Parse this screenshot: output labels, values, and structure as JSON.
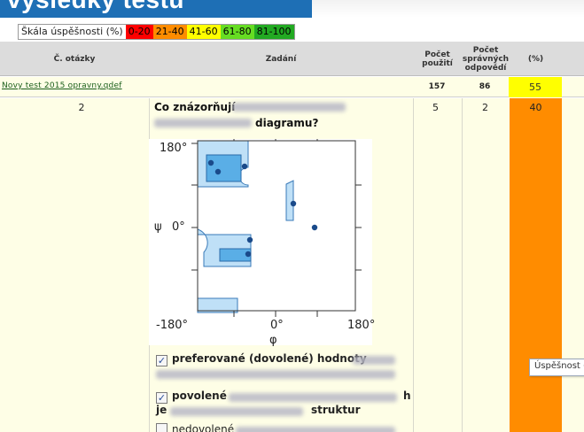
{
  "banner": {
    "title": "výsledky testu",
    "color": "#1e6fb5"
  },
  "scale": {
    "label": "Škála úspěšnosti (%)",
    "ranges": [
      {
        "text": "0-20",
        "color": "#ff0000"
      },
      {
        "text": "21-40",
        "color": "#ff8c00"
      },
      {
        "text": "41-60",
        "color": "#ffff00"
      },
      {
        "text": "61-80",
        "color": "#66dd22"
      },
      {
        "text": "81-100",
        "color": "#22aa22"
      }
    ]
  },
  "table": {
    "headers": {
      "question_no": "Č. otázky",
      "assignment": "Zadání",
      "uses": "Počet použití",
      "correct": "Počet správných odpovědí",
      "percent": "(%)"
    },
    "test_row": {
      "name": "Novy test 2015 opravny.qdef",
      "uses": "157",
      "correct": "86",
      "percent": "55"
    },
    "question_row": {
      "number": "2",
      "uses": "5",
      "correct": "2",
      "percent": "40",
      "text_start": "Co znázorňují",
      "text_end": "diagramu?",
      "plot": {
        "y_axis_label": "ψ",
        "x_axis_label": "φ",
        "y_ticks": [
          "180°",
          "0°",
          "-180°"
        ],
        "x_ticks": [
          "0°",
          "180°"
        ]
      },
      "options": [
        {
          "checked": true,
          "label": "preferované (dovolené) hodnoty"
        },
        {
          "checked": true,
          "label": "povolené",
          "label_tail": "h",
          "line2_start": "je",
          "line2_end": "struktur"
        },
        {
          "checked": false,
          "label": "nedovolené"
        }
      ]
    }
  },
  "tooltip": {
    "text": "Úspěšnost ("
  }
}
